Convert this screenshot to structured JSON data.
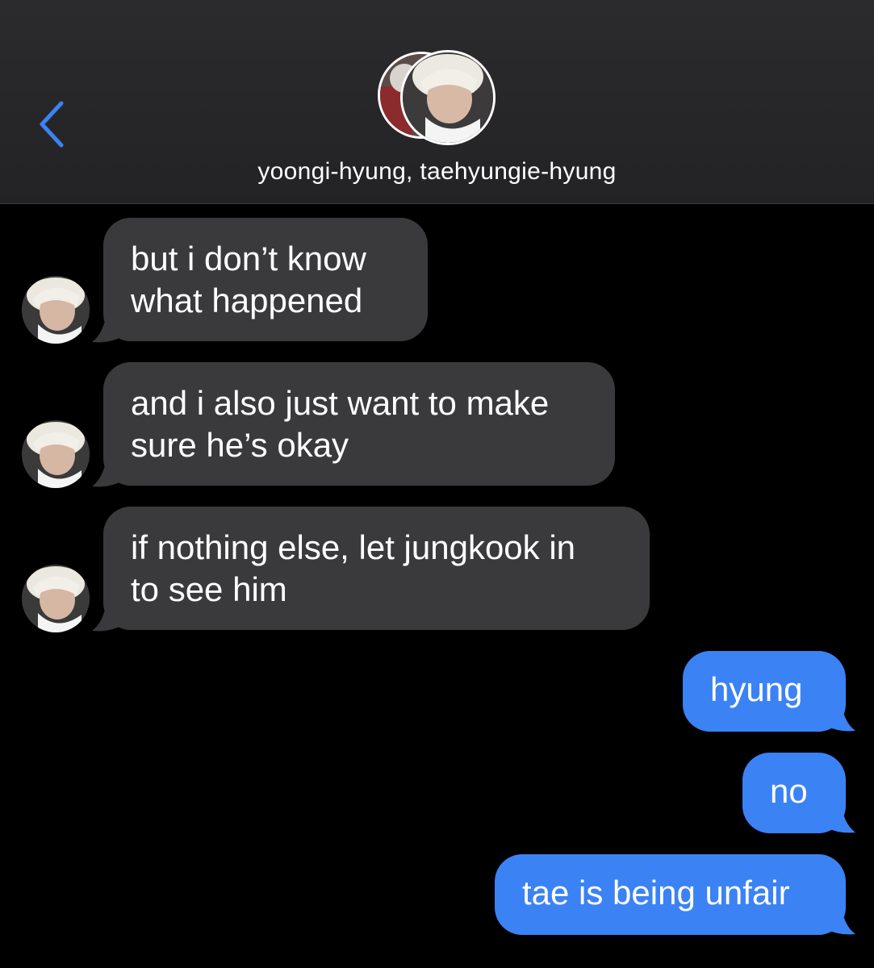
{
  "header": {
    "title": "yoongi-hyung, taehyungie-hyung",
    "back_icon": "chevron-left-icon",
    "accent": "#3b82f4"
  },
  "colors": {
    "background": "#000000",
    "incoming_bubble": "#3a3a3c",
    "outgoing_bubble": "#3b82f4",
    "text": "#ffffff"
  },
  "messages": [
    {
      "direction": "incoming",
      "text": "but i don’t know\nwhat happened"
    },
    {
      "direction": "incoming",
      "text": "and i also just want to make\nsure he’s okay"
    },
    {
      "direction": "incoming",
      "text": "if nothing else, let jungkook in\nto see him"
    },
    {
      "direction": "outgoing",
      "text": "hyung"
    },
    {
      "direction": "outgoing",
      "text": "no"
    },
    {
      "direction": "outgoing",
      "text": "tae is being unfair"
    }
  ]
}
